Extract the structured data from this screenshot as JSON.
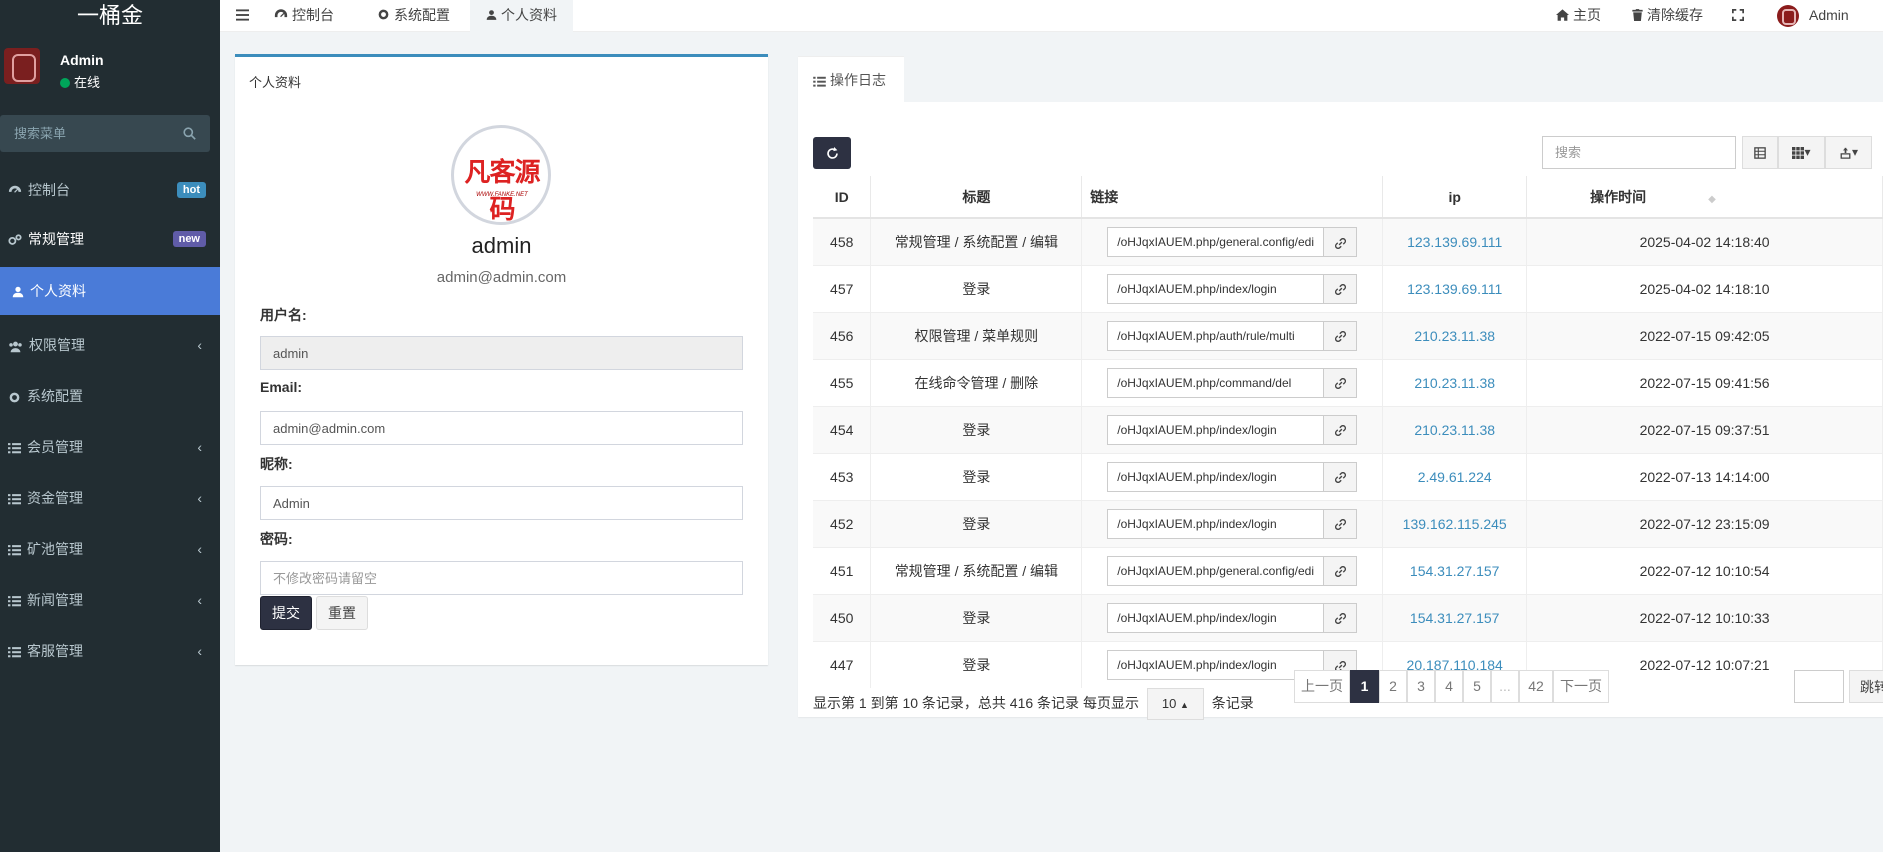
{
  "app": {
    "title": "一桶金"
  },
  "user": {
    "name": "Admin",
    "status": "在线"
  },
  "sidebar": {
    "search_placeholder": "搜索菜单",
    "items": [
      {
        "label": "控制台",
        "badge": "hot",
        "badge_color": "#3c8dbc"
      },
      {
        "label": "常规管理",
        "badge": "new",
        "badge_color": "#605ca8"
      },
      {
        "label": "个人资料"
      },
      {
        "label": "权限管理"
      },
      {
        "label": "系统配置"
      },
      {
        "label": "会员管理"
      },
      {
        "label": "资金管理"
      },
      {
        "label": "矿池管理"
      },
      {
        "label": "新闻管理"
      },
      {
        "label": "客服管理"
      }
    ]
  },
  "header": {
    "tabs": [
      {
        "label": "控制台",
        "icon": "dashboard-icon"
      },
      {
        "label": "系统配置",
        "icon": "gear-icon"
      },
      {
        "label": "个人资料",
        "icon": "user-icon"
      }
    ],
    "home": "主页",
    "clear_cache": "清除缓存",
    "user": "Admin"
  },
  "profile": {
    "panel_title": "个人资料",
    "avatar_text": "凡客源码",
    "avatar_subtext": "WWW.FANKE.NET",
    "name": "admin",
    "email": "admin@admin.com",
    "fields": {
      "username_label": "用户名:",
      "username_value": "admin",
      "email_label": "Email:",
      "email_value": "admin@admin.com",
      "nickname_label": "昵称:",
      "nickname_value": "Admin",
      "password_label": "密码:",
      "password_placeholder": "不修改密码请留空"
    },
    "submit": "提交",
    "reset": "重置"
  },
  "log": {
    "tab": "操作日志",
    "search_placeholder": "搜索",
    "columns": [
      "ID",
      "标题",
      "链接",
      "ip",
      "操作时间"
    ],
    "rows": [
      {
        "id": "458",
        "title": "常规管理 / 系统配置 / 编辑",
        "url": "/oHJqxIAUEM.php/general.config/edit",
        "ip": "123.139.69.111",
        "time": "2025-04-02 14:18:40"
      },
      {
        "id": "457",
        "title": "登录",
        "url": "/oHJqxIAUEM.php/index/login",
        "ip": "123.139.69.111",
        "time": "2025-04-02 14:18:10"
      },
      {
        "id": "456",
        "title": "权限管理 / 菜单规则",
        "url": "/oHJqxIAUEM.php/auth/rule/multi",
        "ip": "210.23.11.38",
        "time": "2022-07-15 09:42:05"
      },
      {
        "id": "455",
        "title": "在线命令管理 / 删除",
        "url": "/oHJqxIAUEM.php/command/del",
        "ip": "210.23.11.38",
        "time": "2022-07-15 09:41:56"
      },
      {
        "id": "454",
        "title": "登录",
        "url": "/oHJqxIAUEM.php/index/login",
        "ip": "210.23.11.38",
        "time": "2022-07-15 09:37:51"
      },
      {
        "id": "453",
        "title": "登录",
        "url": "/oHJqxIAUEM.php/index/login",
        "ip": "2.49.61.224",
        "time": "2022-07-13 14:14:00"
      },
      {
        "id": "452",
        "title": "登录",
        "url": "/oHJqxIAUEM.php/index/login",
        "ip": "139.162.115.245",
        "time": "2022-07-12 23:15:09"
      },
      {
        "id": "451",
        "title": "常规管理 / 系统配置 / 编辑",
        "url": "/oHJqxIAUEM.php/general.config/edit",
        "ip": "154.31.27.157",
        "time": "2022-07-12 10:10:54"
      },
      {
        "id": "450",
        "title": "登录",
        "url": "/oHJqxIAUEM.php/index/login",
        "ip": "154.31.27.157",
        "time": "2022-07-12 10:10:33"
      },
      {
        "id": "447",
        "title": "登录",
        "url": "/oHJqxIAUEM.php/index/login",
        "ip": "20.187.110.184",
        "time": "2022-07-12 10:07:21"
      }
    ],
    "summary_prefix": "显示第 1 到第 10 条记录，总共 416 条记录 每页显示",
    "page_size": "10",
    "summary_suffix": "条记录",
    "pagination": {
      "prev": "上一页",
      "pages": [
        "1",
        "2",
        "3",
        "4",
        "5",
        "...",
        "42"
      ],
      "next": "下一页",
      "jump": "跳转"
    }
  }
}
